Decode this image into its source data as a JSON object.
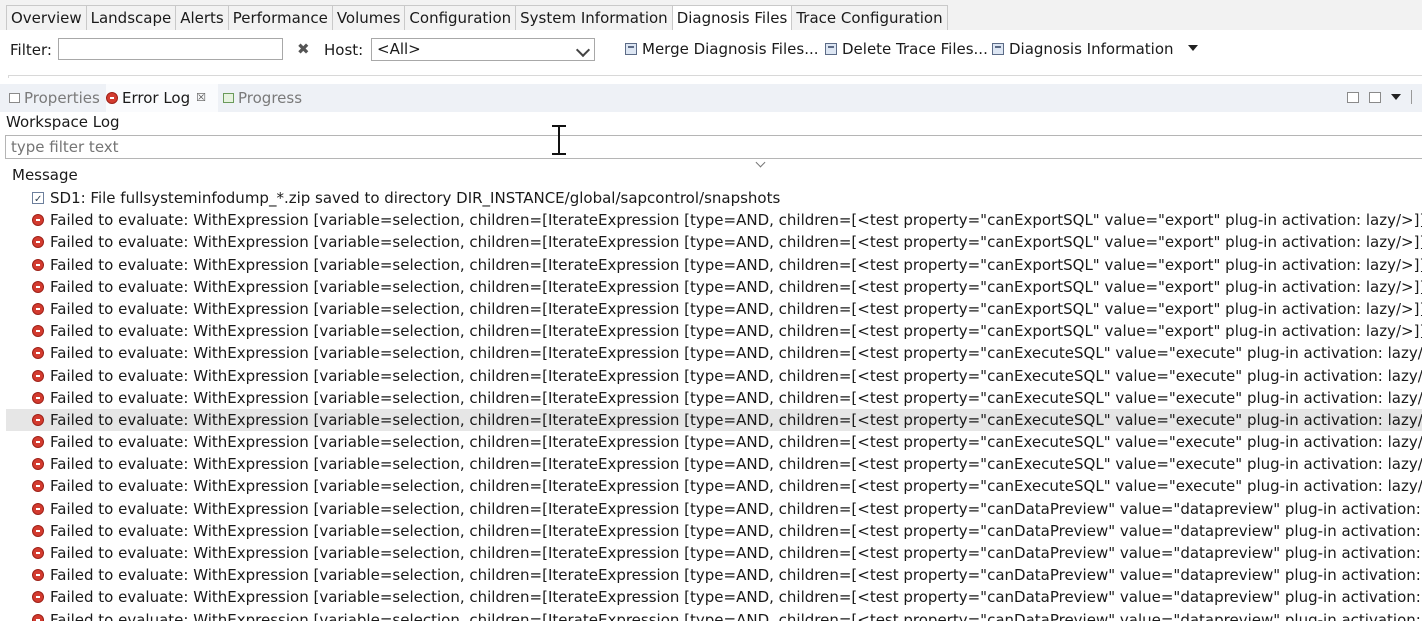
{
  "top_tabs": [
    {
      "label": "Overview"
    },
    {
      "label": "Landscape"
    },
    {
      "label": "Alerts"
    },
    {
      "label": "Performance"
    },
    {
      "label": "Volumes"
    },
    {
      "label": "Configuration"
    },
    {
      "label": "System Information"
    },
    {
      "label": "Diagnosis Files"
    },
    {
      "label": "Trace Configuration"
    }
  ],
  "active_top_tab": "Diagnosis Files",
  "filter_bar": {
    "filter_label": "Filter:",
    "filter_value": "",
    "host_label": "Host:",
    "host_value": "<All>",
    "merge_label": "Merge Diagnosis Files...",
    "delete_label": "Delete Trace Files...",
    "info_label": "Diagnosis Information"
  },
  "view_tabs": [
    {
      "label": "Properties",
      "icon": "properties-icon"
    },
    {
      "label": "Error Log",
      "icon": "error-log-icon"
    },
    {
      "label": "Progress",
      "icon": "progress-icon"
    }
  ],
  "active_view_tab": "Error Log",
  "log": {
    "title": "Workspace Log",
    "filter_placeholder": "type filter text",
    "column_header": "Message",
    "rows": [
      {
        "type": "info",
        "message": "SD1: File fullsysteminfodump_*.zip saved to directory DIR_INSTANCE/global/sapcontrol/snapshots"
      },
      {
        "type": "error",
        "message": "Failed to evaluate: WithExpression [variable=selection, children=[IterateExpression [type=AND, children=[<test property=\"canExportSQL\" value=\"export\" plug-in activation: lazy/>]]]]"
      },
      {
        "type": "error",
        "message": "Failed to evaluate: WithExpression [variable=selection, children=[IterateExpression [type=AND, children=[<test property=\"canExportSQL\" value=\"export\" plug-in activation: lazy/>]]]]"
      },
      {
        "type": "error",
        "message": "Failed to evaluate: WithExpression [variable=selection, children=[IterateExpression [type=AND, children=[<test property=\"canExportSQL\" value=\"export\" plug-in activation: lazy/>]]]]"
      },
      {
        "type": "error",
        "message": "Failed to evaluate: WithExpression [variable=selection, children=[IterateExpression [type=AND, children=[<test property=\"canExportSQL\" value=\"export\" plug-in activation: lazy/>]]]]"
      },
      {
        "type": "error",
        "message": "Failed to evaluate: WithExpression [variable=selection, children=[IterateExpression [type=AND, children=[<test property=\"canExportSQL\" value=\"export\" plug-in activation: lazy/>]]]]"
      },
      {
        "type": "error",
        "message": "Failed to evaluate: WithExpression [variable=selection, children=[IterateExpression [type=AND, children=[<test property=\"canExportSQL\" value=\"export\" plug-in activation: lazy/>]]]]"
      },
      {
        "type": "error",
        "message": "Failed to evaluate: WithExpression [variable=selection, children=[IterateExpression [type=AND, children=[<test property=\"canExecuteSQL\" value=\"execute\" plug-in activation: lazy/>]]]]"
      },
      {
        "type": "error",
        "message": "Failed to evaluate: WithExpression [variable=selection, children=[IterateExpression [type=AND, children=[<test property=\"canExecuteSQL\" value=\"execute\" plug-in activation: lazy/>]]]]"
      },
      {
        "type": "error",
        "message": "Failed to evaluate: WithExpression [variable=selection, children=[IterateExpression [type=AND, children=[<test property=\"canExecuteSQL\" value=\"execute\" plug-in activation: lazy/>]]]]"
      },
      {
        "type": "error",
        "selected": true,
        "message": "Failed to evaluate: WithExpression [variable=selection, children=[IterateExpression [type=AND, children=[<test property=\"canExecuteSQL\" value=\"execute\" plug-in activation: lazy/>]]]]"
      },
      {
        "type": "error",
        "message": "Failed to evaluate: WithExpression [variable=selection, children=[IterateExpression [type=AND, children=[<test property=\"canExecuteSQL\" value=\"execute\" plug-in activation: lazy/>]]]]"
      },
      {
        "type": "error",
        "message": "Failed to evaluate: WithExpression [variable=selection, children=[IterateExpression [type=AND, children=[<test property=\"canExecuteSQL\" value=\"execute\" plug-in activation: lazy/>]]]]"
      },
      {
        "type": "error",
        "message": "Failed to evaluate: WithExpression [variable=selection, children=[IterateExpression [type=AND, children=[<test property=\"canExecuteSQL\" value=\"execute\" plug-in activation: lazy/>]]]]"
      },
      {
        "type": "error",
        "message": "Failed to evaluate: WithExpression [variable=selection, children=[IterateExpression [type=AND, children=[<test property=\"canDataPreview\" value=\"datapreview\" plug-in activation: lazy/>]]]]"
      },
      {
        "type": "error",
        "message": "Failed to evaluate: WithExpression [variable=selection, children=[IterateExpression [type=AND, children=[<test property=\"canDataPreview\" value=\"datapreview\" plug-in activation: lazy/>]]]]"
      },
      {
        "type": "error",
        "message": "Failed to evaluate: WithExpression [variable=selection, children=[IterateExpression [type=AND, children=[<test property=\"canDataPreview\" value=\"datapreview\" plug-in activation: lazy/>]]]]"
      },
      {
        "type": "error",
        "message": "Failed to evaluate: WithExpression [variable=selection, children=[IterateExpression [type=AND, children=[<test property=\"canDataPreview\" value=\"datapreview\" plug-in activation: lazy/>]]]]"
      },
      {
        "type": "error",
        "message": "Failed to evaluate: WithExpression [variable=selection, children=[IterateExpression [type=AND, children=[<test property=\"canDataPreview\" value=\"datapreview\" plug-in activation: lazy/>]]]]"
      },
      {
        "type": "error",
        "message": "Failed to evaluate: WithExpression [variable=selection, children=[IterateExpression [type=AND, children=[<test property=\"canDataPreview\" value=\"datapreview\" plug-in activation: lazy/>]]]]"
      }
    ]
  },
  "colors": {
    "error_icon": "#d33b2f",
    "selected_row": "#e6e6e6",
    "view_bar": "#eef1f6",
    "tab_bar": "#f2f2f2"
  }
}
